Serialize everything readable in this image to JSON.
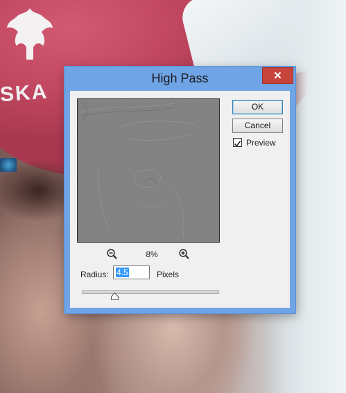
{
  "background": {
    "bandana_text": "SKA"
  },
  "dialog": {
    "title": "High Pass",
    "close_glyph": "✕",
    "buttons": {
      "ok": "OK",
      "cancel": "Cancel"
    },
    "preview": {
      "label": "Preview",
      "checked": true
    },
    "zoom": {
      "level": "8%",
      "zoom_out_icon": "zoom-out-magnifier",
      "zoom_in_icon": "zoom-in-magnifier"
    },
    "radius": {
      "label": "Radius:",
      "value": "4.5",
      "units": "Pixels",
      "slider_fraction": 0.24
    },
    "colors": {
      "titlebar": "#6fa4e6",
      "close": "#c7443c",
      "client": "#f0f0f0",
      "preview_fill": "#7d7d7d"
    }
  }
}
